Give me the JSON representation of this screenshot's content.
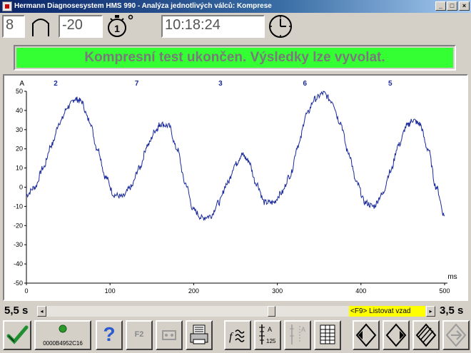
{
  "window": {
    "title": "Hermann Diagnosesystem HMS 990 - Analýza jednotlivých válců: Komprese",
    "minimize": "_",
    "maximize": "□",
    "close": "×"
  },
  "topbar": {
    "cylinder_count": "8",
    "temperature": "-20",
    "stopwatch_digit": "1",
    "time": "10:18:24"
  },
  "status_message": "Kompresní test ukončen. Výsledky lze vyvolat.",
  "chart_data": {
    "type": "line",
    "title": "",
    "xlabel": "ms",
    "ylabel": "A",
    "xlim": [
      0,
      500
    ],
    "ylim": [
      -50,
      50
    ],
    "xticks": [
      0,
      100,
      200,
      300,
      400,
      500
    ],
    "yticks": [
      50,
      40,
      30,
      20,
      10,
      0,
      -10,
      -20,
      -30,
      -40,
      -50
    ],
    "cylinder_markers": [
      {
        "label": "2",
        "x": 35
      },
      {
        "label": "7",
        "x": 132
      },
      {
        "label": "3",
        "x": 232
      },
      {
        "label": "6",
        "x": 333
      },
      {
        "label": "5",
        "x": 435
      }
    ],
    "series": [
      {
        "color": "#1a2a9a",
        "x": [
          0,
          10,
          20,
          30,
          40,
          50,
          58,
          65,
          75,
          85,
          95,
          105,
          115,
          125,
          135,
          145,
          155,
          160,
          170,
          180,
          190,
          200,
          210,
          220,
          230,
          240,
          250,
          258,
          265,
          275,
          285,
          295,
          305,
          315,
          325,
          335,
          345,
          355,
          365,
          375,
          385,
          395,
          405,
          415,
          425,
          435,
          445,
          455,
          462,
          470,
          480,
          490,
          500
        ],
        "y": [
          -4,
          0,
          10,
          22,
          34,
          42,
          46,
          45,
          35,
          20,
          5,
          -4,
          -5,
          0,
          10,
          22,
          30,
          33,
          32,
          20,
          2,
          -12,
          -16,
          -15,
          -8,
          2,
          12,
          17,
          14,
          2,
          -8,
          -8,
          -3,
          6,
          22,
          38,
          46,
          49,
          45,
          34,
          18,
          2,
          -8,
          -10,
          -4,
          8,
          22,
          32,
          35,
          33,
          20,
          0,
          -15
        ]
      }
    ]
  },
  "slider": {
    "left_time": "5,5 s",
    "right_time": "3,5 s",
    "hint": "<F9> Listovat vzad",
    "left_arrow": "◂",
    "right_arrow": "▸"
  },
  "toolbar": {
    "device_id": "0000B4952C16",
    "f2_label": "F2",
    "help": "?",
    "icon_125": "125"
  },
  "colors": {
    "banner_bg": "#33ff33",
    "banner_text": "#7a7a7a",
    "trace": "#1a2a9a",
    "face": "#d4d0c8",
    "hint_bg": "#ffff00",
    "led": "#2a9a2a",
    "check": "#1f8f2f"
  }
}
